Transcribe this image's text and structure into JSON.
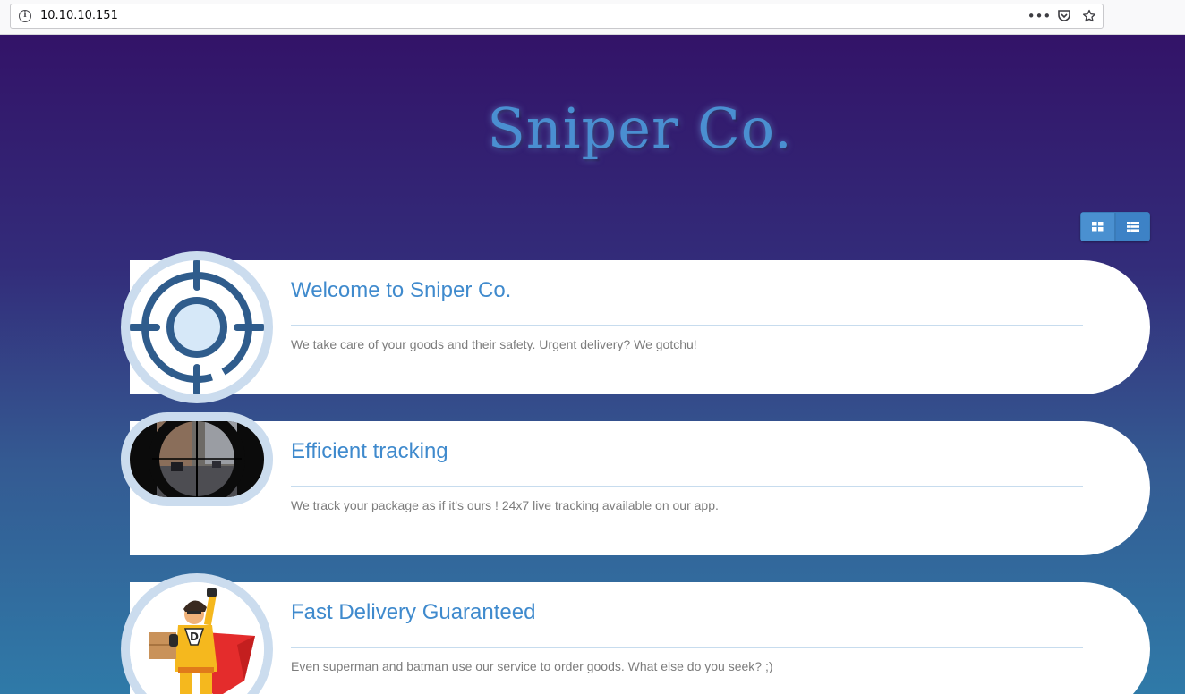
{
  "browser": {
    "url": "10.10.10.151",
    "info_icon": "info-icon",
    "menu_icon": "more-icon",
    "pocket_icon": "pocket-icon",
    "bookmark_icon": "star-icon"
  },
  "site": {
    "title": "Sniper Co.",
    "colors": {
      "title": "#4a8fd1",
      "accent": "#3f8acd",
      "ring": "#cbdcee"
    }
  },
  "view_toggle": {
    "grid_icon": "grid-icon",
    "list_icon": "list-icon"
  },
  "cards": [
    {
      "title": "Welcome to Sniper Co.",
      "text": "We take care of your goods and their safety. Urgent delivery? We gotchu!",
      "icon": "crosshair-icon"
    },
    {
      "title": "Efficient tracking",
      "text": "We track your package as if it's ours ! 24x7 live tracking available on our app.",
      "icon": "scope-view-image"
    },
    {
      "title": "Fast Delivery Guaranteed",
      "text": "Even superman and batman use our service to order goods. What else do you seek? ;)",
      "icon": "delivery-hero-image"
    }
  ]
}
